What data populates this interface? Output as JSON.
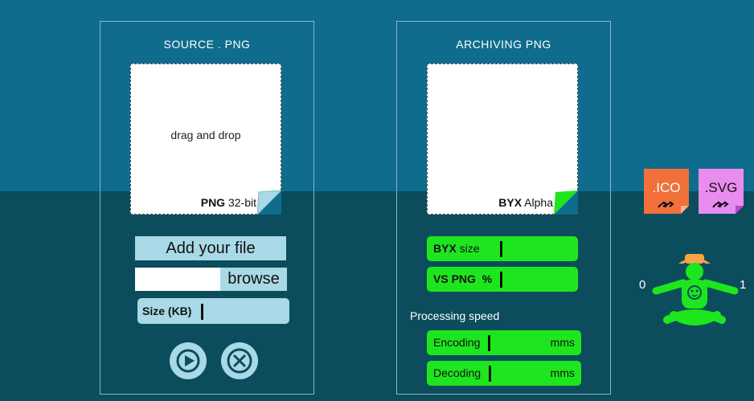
{
  "source_panel": {
    "title": "SOURCE . PNG",
    "dropzone_text": "drag and drop",
    "format_bold": "PNG",
    "format_rest": " 32-bit",
    "add_file_label": "Add your file",
    "browse_label": "browse",
    "size_label": "Size (KB)"
  },
  "archive_panel": {
    "title": "ARCHIVING PNG",
    "format_bold": "BYX",
    "format_rest": " Alpha",
    "byx_size_bold": "BYX",
    "byx_size_rest": " size",
    "vs_png_label": "VS PNG  %",
    "processing_label": "Processing speed",
    "encoding_label": "Encoding",
    "decoding_label": "Decoding",
    "unit": "mms"
  },
  "side": {
    "ico_label": ".ICO",
    "svg_label": ".SVG",
    "slider_min": "0",
    "slider_max": "1"
  },
  "colors": {
    "bg_top": "#0f6c8d",
    "bg_bottom": "#0b4d5c",
    "green": "#1ee61e",
    "light_blue": "#a9d9e6",
    "ico_orange": "#f2703a",
    "svg_pink": "#e88cf0",
    "hat_orange": "#f4a54a"
  },
  "icons": [
    "play-icon",
    "close-icon",
    "forward-arrows-icon",
    "mascot-icon"
  ]
}
